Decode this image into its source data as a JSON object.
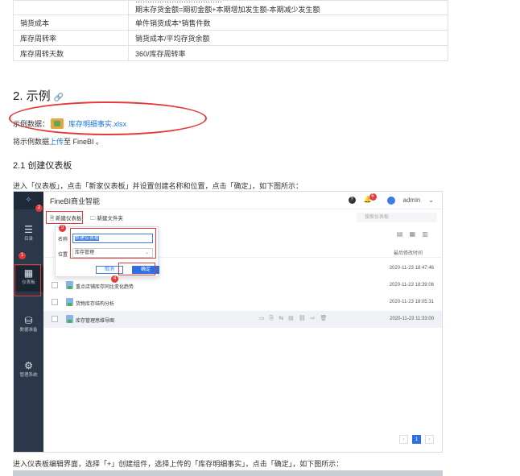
{
  "table": {
    "rows": [
      {
        "label": "",
        "formula": "期末存货金额=期初金额+本期增加发生额-本期减少发生额",
        "cut": "………………………………"
      },
      {
        "label": "销货成本",
        "formula": "单件销货成本*销售件数"
      },
      {
        "label": "库存周转率",
        "formula": "销货成本/平均存货余额"
      },
      {
        "label": "库存周转天数",
        "formula": "360/库存周转率"
      }
    ]
  },
  "section": {
    "h2": "2. 示例",
    "link_icon": "link-icon",
    "sample_label": "示例数据：",
    "sample_file": "库存明细事实.xlsx",
    "upload_prefix": "将示例数据",
    "upload_link": "上传",
    "upload_suffix": "至 FineBI 。",
    "h3": "2.1 创建仪表板",
    "para": "进入「仪表板」，点击「新家仪表板」并设置创建名称和位置，点击「确定」，如下图所示：",
    "para2": "进入仪表板编辑界面，选择「+」创建组件，选择上传的「库存明细事实」，点击「确定」，如下图所示："
  },
  "screenshot": {
    "app_title": "FineBI商业智能",
    "user": "admin",
    "notif_count": "6",
    "sidebar": [
      {
        "icon": "list-icon",
        "label": "目录"
      },
      {
        "icon": "dashboard-icon",
        "label": "仪表板"
      },
      {
        "icon": "database-icon",
        "label": "数据准备"
      },
      {
        "icon": "gear-icon",
        "label": "管理系统"
      }
    ],
    "toolbar": {
      "new_dashboard": "新建仪表板",
      "new_folder": "新建文件夹",
      "search_placeholder": "搜索仪表板"
    },
    "col_head": "最后修改时间",
    "rows": [
      {
        "name": "",
        "time": "2020-11-23 18:47:46"
      },
      {
        "name": "重点店铺库存同比变化趋势",
        "time": "2020-11-23 18:39:06"
      },
      {
        "name": "货物库存结构分析",
        "time": "2020-11-23 18:05:31"
      },
      {
        "name": "库存管理思维导图",
        "time": "2020-11-23 11:33:00"
      }
    ],
    "dialog": {
      "name_label": "名称",
      "name_value": "新建仪表板",
      "loc_label": "位置",
      "loc_value": "库存管理",
      "cancel": "取消",
      "ok": "确定"
    },
    "markers": [
      "1",
      "2",
      "3",
      "4"
    ],
    "page": "1"
  }
}
